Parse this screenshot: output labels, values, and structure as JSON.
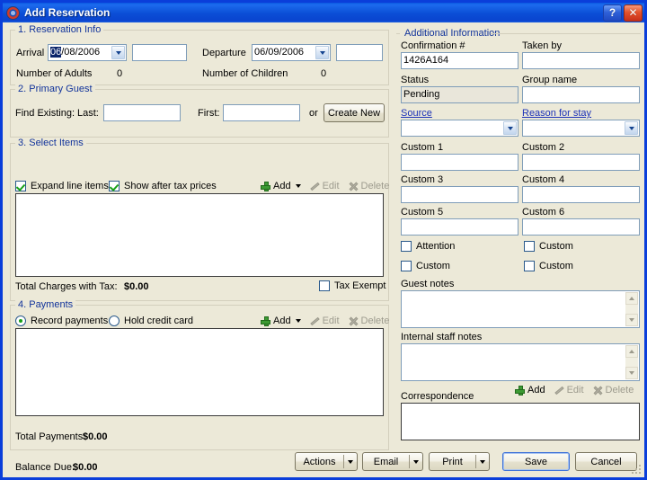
{
  "window": {
    "title": "Add Reservation",
    "icon": "app-icon",
    "help_label": "?",
    "close_label": "✕"
  },
  "reservation_info": {
    "legend": "1. Reservation Info",
    "arrival_label": "Arrival",
    "arrival_value_selected": "06",
    "arrival_value_rest": "/08/2006",
    "arrival_time_value": "",
    "departure_label": "Departure",
    "departure_value": "06/09/2006",
    "departure_time_value": "",
    "adults_label": "Number of Adults",
    "adults_value": "0",
    "children_label": "Number of Children",
    "children_value": "0"
  },
  "primary_guest": {
    "legend": "2. Primary Guest",
    "find_existing_label": "Find Existing:",
    "last_label": "Last:",
    "last_value": "",
    "first_label": "First:",
    "first_value": "",
    "or_label": "or",
    "create_new_label": "Create New"
  },
  "select_items": {
    "legend": "3. Select Items",
    "expand_line_items_label": "Expand line items",
    "expand_line_items_checked": true,
    "show_after_tax_label": "Show after tax prices",
    "show_after_tax_checked": true,
    "add_label": "Add",
    "edit_label": "Edit",
    "delete_label": "Delete",
    "total_label": "Total Charges with Tax:",
    "total_value": "$0.00",
    "tax_exempt_label": "Tax Exempt",
    "tax_exempt_checked": false,
    "rows": []
  },
  "payments": {
    "legend": "4. Payments",
    "record_payments_label": "Record payments",
    "record_payments_selected": true,
    "hold_credit_card_label": "Hold credit card",
    "hold_credit_card_selected": false,
    "add_label": "Add",
    "edit_label": "Edit",
    "delete_label": "Delete",
    "total_label": "Total Payments:",
    "total_value": "$0.00",
    "rows": []
  },
  "balance": {
    "label": "Balance Due:",
    "value": "$0.00"
  },
  "footer_buttons": {
    "actions_label": "Actions",
    "email_label": "Email",
    "print_label": "Print",
    "save_label": "Save",
    "cancel_label": "Cancel"
  },
  "additional_information": {
    "legend": "Additional Information",
    "confirmation_label": "Confirmation #",
    "confirmation_value": "1426A164",
    "taken_by_label": "Taken by",
    "taken_by_value": "",
    "status_label": "Status",
    "status_value": "Pending",
    "group_name_label": "Group name",
    "group_name_value": "",
    "source_label": "Source",
    "source_value": "",
    "reason_label": "Reason for stay",
    "reason_value": "",
    "custom_fields": [
      {
        "label": "Custom 1",
        "value": ""
      },
      {
        "label": "Custom 2",
        "value": ""
      },
      {
        "label": "Custom 3",
        "value": ""
      },
      {
        "label": "Custom 4",
        "value": ""
      },
      {
        "label": "Custom 5",
        "value": ""
      },
      {
        "label": "Custom 6",
        "value": ""
      }
    ],
    "checkboxes": [
      {
        "label": "Attention",
        "checked": false
      },
      {
        "label": "Custom",
        "checked": false
      },
      {
        "label": "Custom",
        "checked": false
      },
      {
        "label": "Custom",
        "checked": false
      }
    ],
    "guest_notes_label": "Guest notes",
    "guest_notes_value": "",
    "internal_notes_label": "Internal staff notes",
    "internal_notes_value": "",
    "correspondence_label": "Correspondence",
    "correspondence_add_label": "Add",
    "correspondence_edit_label": "Edit",
    "correspondence_delete_label": "Delete"
  },
  "colors": {
    "window_border": "#0A3EDA",
    "title_bar": "#0B4ED6",
    "dialog_bg": "#ECE9D8",
    "group_legend": "#12349B",
    "link": "#1B31B8",
    "accent_green": "#3C9A33",
    "field_border": "#7F9DB9"
  }
}
